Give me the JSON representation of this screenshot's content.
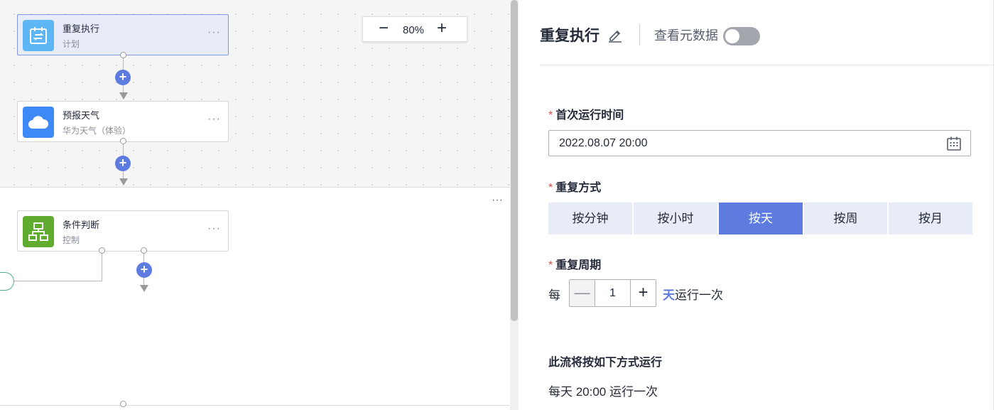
{
  "canvas": {
    "zoom": {
      "minus": "−",
      "value": "80%",
      "plus": "+"
    },
    "nodes": [
      {
        "title": "重复执行",
        "subtitle": "计划",
        "more": "···",
        "icon": "calendar-repeat-icon",
        "color": "#5fb6f5"
      },
      {
        "title": "预报天气",
        "subtitle": "华为天气（体验）",
        "more": "···",
        "icon": "cloud-icon",
        "color": "#3d8af7"
      },
      {
        "title": "条件判断",
        "subtitle": "控制",
        "more": "···",
        "icon": "flowchart-icon",
        "color": "#5fac2f"
      }
    ],
    "add_button": "+",
    "section_more": "···"
  },
  "panel": {
    "title": "重复执行",
    "edit_icon": "pencil-icon",
    "metadata_label": "查看元数据",
    "metadata_toggle": false,
    "first_run": {
      "label": "首次运行时间",
      "required": "*",
      "value": "2022.08.07 20:00",
      "icon": "calendar-icon"
    },
    "repeat_mode": {
      "label": "重复方式",
      "required": "*",
      "options": [
        "按分钟",
        "按小时",
        "按天",
        "按周",
        "按月"
      ],
      "selected": "按天"
    },
    "repeat_period": {
      "label": "重复周期",
      "required": "*",
      "prefix": "每",
      "minus": "—",
      "value": "1",
      "plus": "+",
      "unit": "天",
      "suffix": "运行一次"
    },
    "summary": {
      "title": "此流将按如下方式运行",
      "text": "每天 20:00 运行一次"
    }
  }
}
